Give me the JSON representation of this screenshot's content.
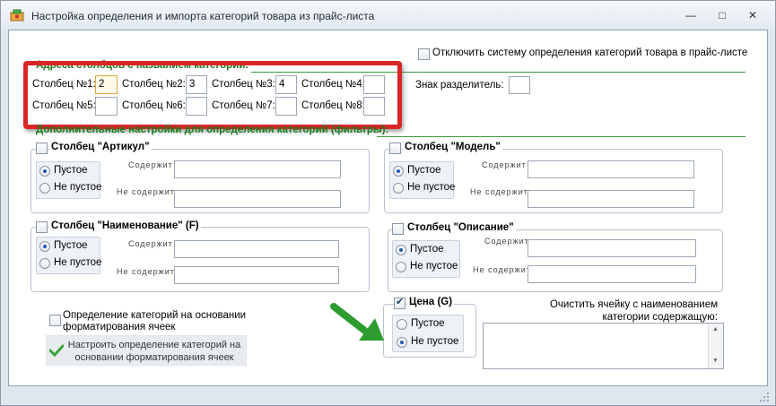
{
  "window": {
    "title": "Настройка определения и импорта категорий товара из прайс-листа",
    "minimize": "—",
    "maximize": "□",
    "close": "✕"
  },
  "disable_system": {
    "label": "Отключить систему определения категорий товара в прайс-листе",
    "checked": false
  },
  "columns": {
    "title": "Адреса столбцов с названием категории:",
    "c1_label": "Столбец №1:",
    "c1_value": "2",
    "c2_label": "Столбец №2:",
    "c2_value": "3",
    "c3_label": "Столбец №3:",
    "c3_value": "4",
    "c4_label": "Столбец №4:",
    "c4_value": "",
    "c5_label": "Столбец №5:",
    "c5_value": "",
    "c6_label": "Столбец №6:",
    "c6_value": "",
    "c7_label": "Столбец №7:",
    "c7_value": "",
    "c8_label": "Столбец №8:",
    "c8_value": "",
    "separator_label": "Знак разделитель:",
    "separator_value": ""
  },
  "filters": {
    "title": "Дополнительные настройки для определения категорий (фильтры):",
    "article": {
      "label": "Столбец \"Артикул\"",
      "empty": "Пустое",
      "not_empty": "Не пустое",
      "contains": "Содержит",
      "not_contains": "Не содержит",
      "selected": "empty"
    },
    "model": {
      "label": "Столбец \"Модель\"",
      "empty": "Пустое",
      "not_empty": "Не пустое",
      "contains": "Содержит",
      "not_contains": "Не содержит",
      "selected": "empty"
    },
    "name": {
      "label": "Столбец \"Наименование\" (F)",
      "empty": "Пустое",
      "not_empty": "Не пустое",
      "contains": "Содержит",
      "not_contains": "Не содержит",
      "selected": "empty"
    },
    "description": {
      "label": "Столбец \"Описание\"",
      "empty": "Пустое",
      "not_empty": "Не пустое",
      "contains": "Содержит",
      "not_contains": "Не содержит",
      "selected": "empty"
    },
    "price": {
      "label": "Цена (G)",
      "checked": true,
      "empty": "Пустое",
      "not_empty": "Не пустое",
      "selected": "not_empty"
    }
  },
  "format": {
    "checkbox_label": "Определение категорий на основании форматирования ячеек",
    "button_label": "Настроить определение категорий на основании форматирования ячеек"
  },
  "clear": {
    "label": "Очистить ячейку с наименованием категории содержащую:",
    "value": ""
  },
  "colors": {
    "accent_green": "#1b7a1b",
    "highlight_red": "#d82626",
    "arrow_green": "#2e9c2e"
  }
}
